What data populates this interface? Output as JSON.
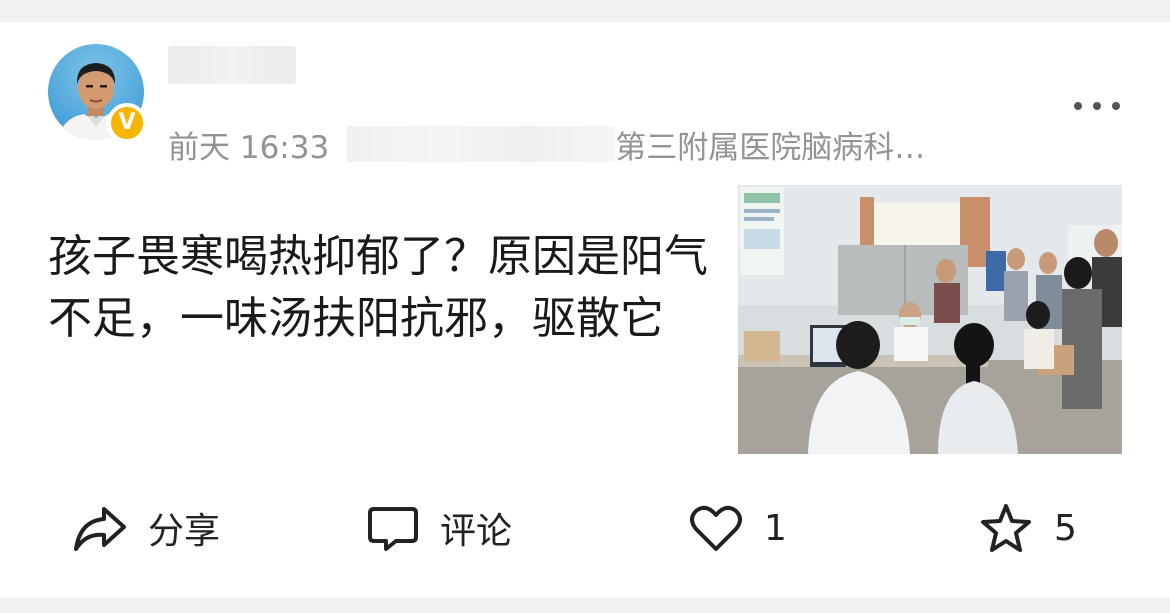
{
  "post": {
    "time": "前天 16:33",
    "source": "第三附属医院脑病科…",
    "text": "孩子畏寒喝热抑郁了？原因是阳气不足，一味汤扶阳抗邪，驱散它",
    "author_verified_badge": "V"
  },
  "actions": {
    "share_label": "分享",
    "comment_label": "评论",
    "like_count": "1",
    "favorite_count": "5"
  },
  "icons": {
    "share": "share-arrow-icon",
    "comment": "comment-bubble-icon",
    "like": "heart-icon",
    "favorite": "star-icon",
    "more": "more-dots-icon"
  },
  "colors": {
    "badge": "#f7b500",
    "meta_text": "#939393",
    "body_text": "#1a1a1a"
  }
}
